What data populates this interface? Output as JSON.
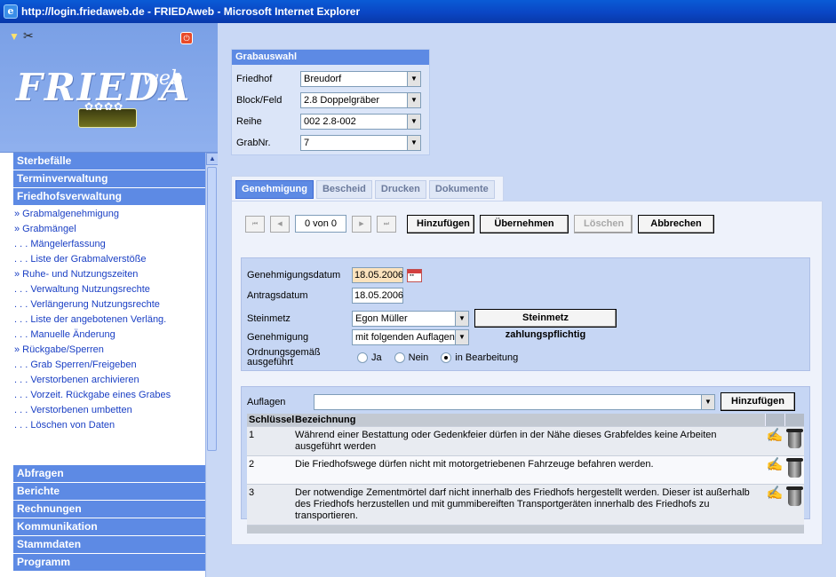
{
  "window": {
    "title": "http://login.friedaweb.de - FRIEDAweb - Microsoft Internet Explorer"
  },
  "logo": {
    "main": "FRIEDA",
    "suffix": "web"
  },
  "nav": {
    "top_sections": [
      "Sterbefälle",
      "Terminverwaltung",
      "Friedhofsverwaltung"
    ],
    "sub_items": [
      "» Grabmalgenehmigung",
      "» Grabmängel",
      ". . . Mängelerfassung",
      ". . . Liste der Grabmalverstöße",
      "» Ruhe- und Nutzungszeiten",
      ". . . Verwaltung Nutzungsrechte",
      ". . . Verlängerung Nutzungsrechte",
      ". . . Liste der angebotenen Verläng.",
      ". . . Manuelle Änderung",
      "» Rückgabe/Sperren",
      ". . . Grab Sperren/Freigeben",
      ". . . Verstorbenen archivieren",
      ". . . Vorzeit. Rückgabe eines Grabes",
      ". . . Verstorbenen umbetten",
      ". . . Löschen von Daten"
    ],
    "bottom_sections": [
      "Abfragen",
      "Berichte",
      "Rechnungen",
      "Kommunikation",
      "Stammdaten",
      "Programm"
    ]
  },
  "grabauswahl": {
    "title": "Grabauswahl",
    "rows": [
      {
        "label": "Friedhof",
        "value": "Breudorf"
      },
      {
        "label": "Block/Feld",
        "value": "2.8 Doppelgräber"
      },
      {
        "label": "Reihe",
        "value": "002 2.8-002"
      },
      {
        "label": "GrabNr.",
        "value": "7"
      }
    ]
  },
  "tabs": [
    "Genehmigung",
    "Bescheid",
    "Drucken",
    "Dokumente"
  ],
  "toolbar": {
    "counter": "0 von 0",
    "add": "Hinzufügen",
    "apply": "Übernehmen",
    "delete": "Löschen",
    "cancel": "Abbrechen"
  },
  "form": {
    "genehmigungsdatum_label": "Genehmigungsdatum",
    "genehmigungsdatum": "18.05.2006",
    "antragsdatum_label": "Antragsdatum",
    "antragsdatum": "18.05.2006",
    "steinmetz_label": "Steinmetz",
    "steinmetz": "Egon Müller",
    "steinmetz_button": "Steinmetz zahlungspflichtig",
    "genehmigung_label": "Genehmigung",
    "genehmigung": "mit folgenden Auflagen (",
    "ausgefuehrt_label_1": "Ordnungsgemäß",
    "ausgefuehrt_label_2": "ausgeführt",
    "options": [
      "Ja",
      "Nein",
      "in Bearbeitung"
    ],
    "selected_option": "in Bearbeitung"
  },
  "auflagen": {
    "label": "Auflagen",
    "value": "",
    "add": "Hinzufügen",
    "columns": [
      "Schlüssel",
      "Bezeichnung"
    ],
    "rows": [
      {
        "key": "1",
        "text": "Während einer Bestattung oder Gedenkfeier dürfen in der Nähe dieses Grabfeldes keine Arbeiten ausgeführt werden"
      },
      {
        "key": "2",
        "text": "Die Friedhofswege dürfen nicht mit motorgetriebenen Fahrzeuge befahren werden."
      },
      {
        "key": "3",
        "text": "Der notwendige Zementmörtel darf nicht innerhalb des Friedhofs hergestellt werden. Dieser ist außerhalb des Friedhofs herzustellen und mit gummibereiften Transportgeräten innerhalb des Friedhofs zu transportieren."
      }
    ]
  }
}
